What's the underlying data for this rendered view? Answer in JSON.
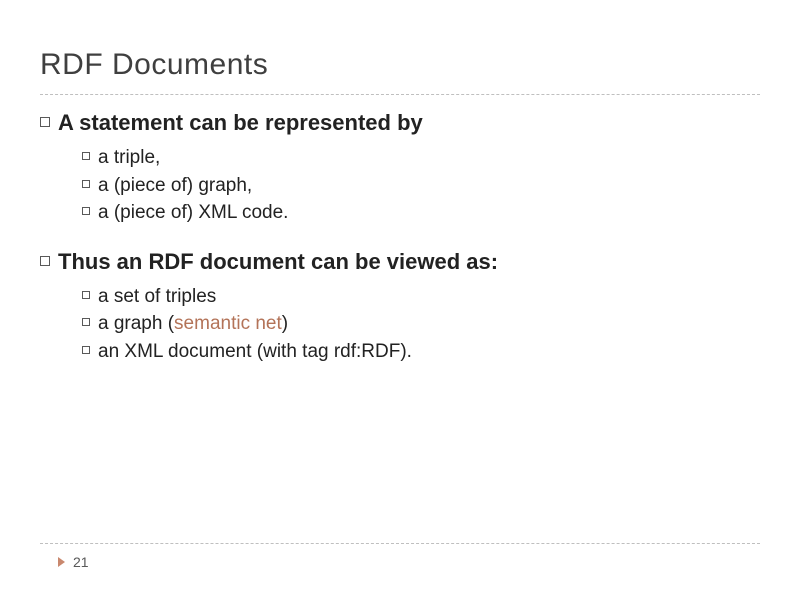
{
  "title": "RDF Documents",
  "bullets": [
    {
      "text": "A statement can be represented by",
      "sub": [
        {
          "text": "a triple,"
        },
        {
          "text": "a (piece of) graph,"
        },
        {
          "text": "a (piece of) XML code."
        }
      ]
    },
    {
      "text": "Thus an RDF document can be viewed as:",
      "sub": [
        {
          "text": "a set of triples"
        },
        {
          "prefix": "a graph (",
          "highlight": "semantic net",
          "suffix": ")"
        },
        {
          "text": "an XML document (with tag rdf:RDF)."
        }
      ]
    }
  ],
  "page_number": "21"
}
